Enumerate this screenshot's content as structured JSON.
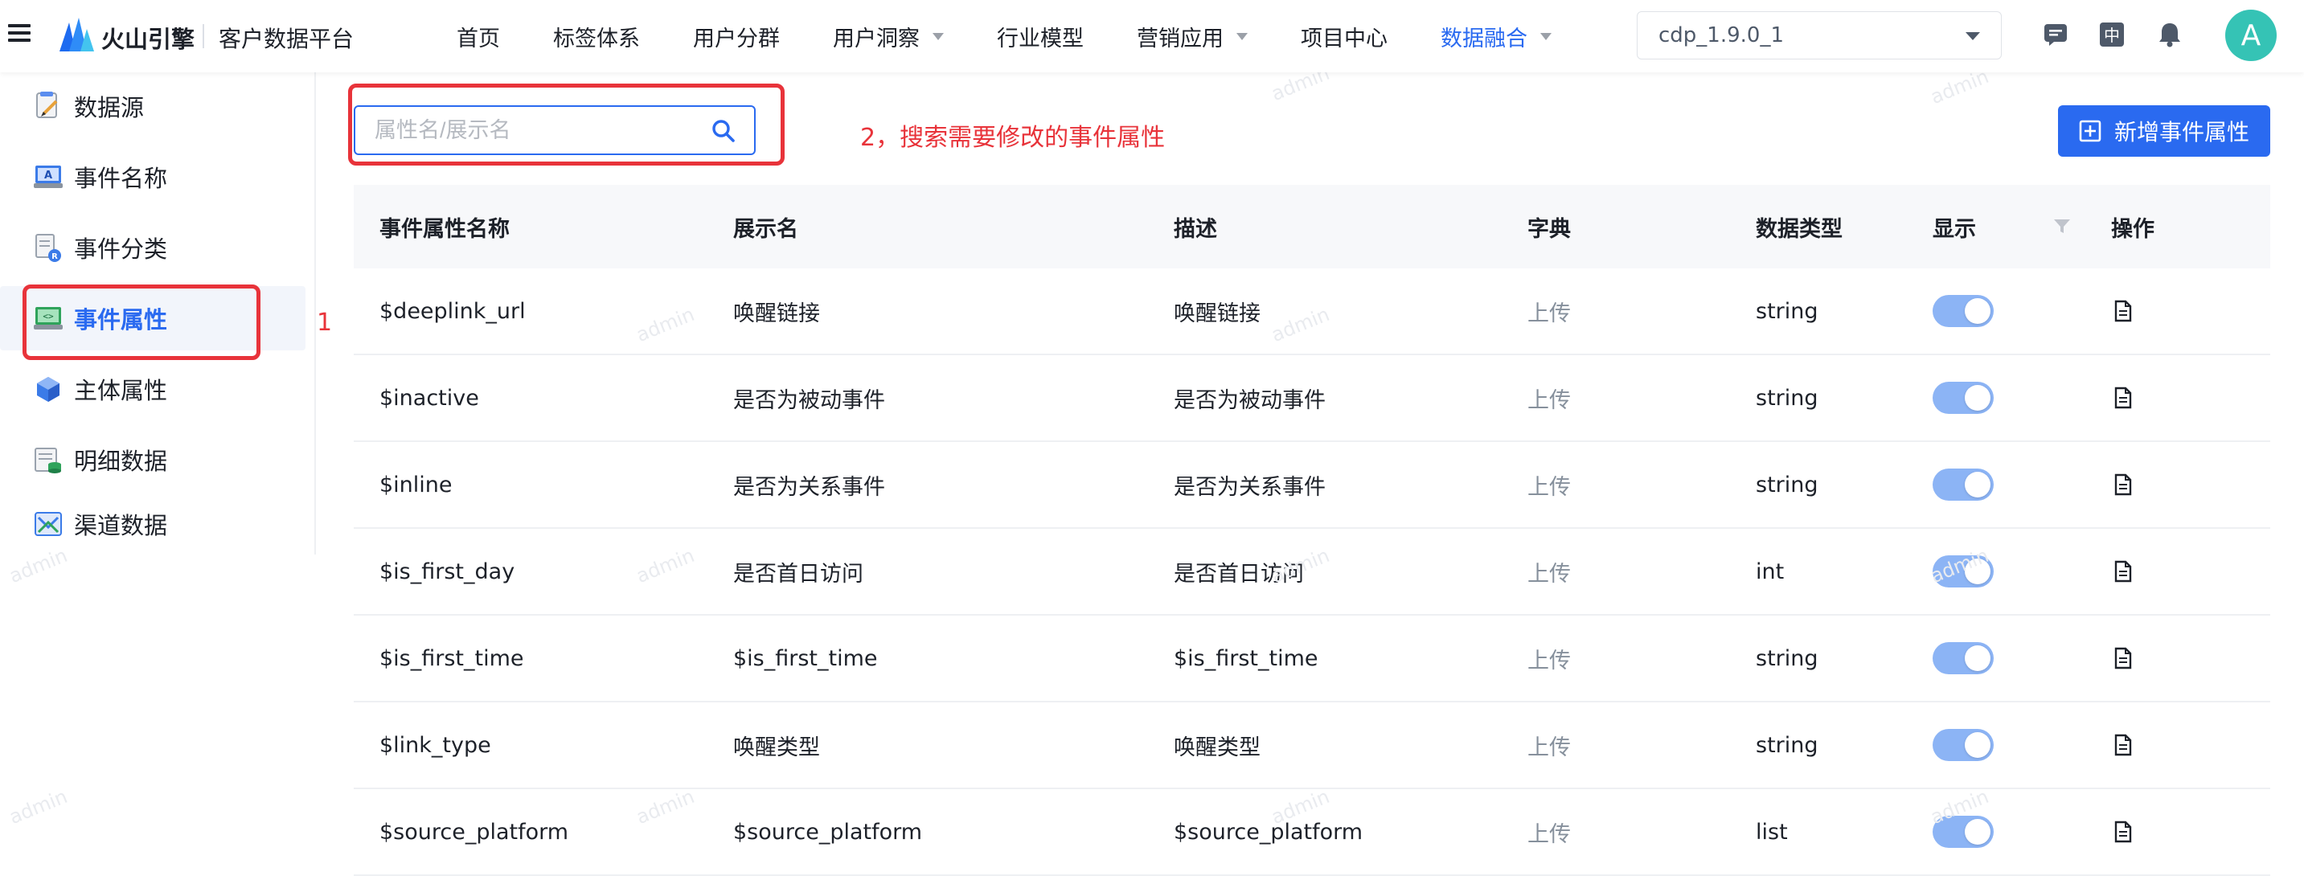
{
  "topbar": {
    "brand": "火山引擎",
    "platform": "客户数据平台",
    "nav": [
      {
        "label": "首页",
        "dropdown": false,
        "active": false
      },
      {
        "label": "标签体系",
        "dropdown": false,
        "active": false
      },
      {
        "label": "用户分群",
        "dropdown": false,
        "active": false
      },
      {
        "label": "用户洞察",
        "dropdown": true,
        "active": false
      },
      {
        "label": "行业模型",
        "dropdown": false,
        "active": false
      },
      {
        "label": "营销应用",
        "dropdown": true,
        "active": false
      },
      {
        "label": "项目中心",
        "dropdown": false,
        "active": false
      },
      {
        "label": "数据融合",
        "dropdown": true,
        "active": true
      }
    ],
    "version": "cdp_1.9.0_1",
    "lang_label": "中",
    "avatar_letter": "A",
    "icons": [
      "message-icon",
      "language-icon",
      "bell-icon"
    ]
  },
  "sidebar": {
    "items": [
      {
        "label": "数据源",
        "icon": "data-source-icon",
        "active": false
      },
      {
        "label": "事件名称",
        "icon": "event-name-icon",
        "active": false
      },
      {
        "label": "事件分类",
        "icon": "event-category-icon",
        "active": false
      },
      {
        "label": "事件属性",
        "icon": "event-property-icon",
        "active": true
      },
      {
        "label": "主体属性",
        "icon": "subject-property-icon",
        "active": false
      },
      {
        "label": "明细数据",
        "icon": "detail-data-icon",
        "active": false
      },
      {
        "label": "渠道数据",
        "icon": "channel-data-icon",
        "active": false
      }
    ]
  },
  "annotations": {
    "step1": "1",
    "step2": "2，搜索需要修改的事件属性"
  },
  "search": {
    "placeholder": "属性名/展示名",
    "value": ""
  },
  "add_button": {
    "label": "新增事件属性"
  },
  "table": {
    "columns": [
      "事件属性名称",
      "展示名",
      "描述",
      "字典",
      "数据类型",
      "显示",
      "操作"
    ],
    "rows": [
      {
        "name": "$deeplink_url",
        "display": "唤醒链接",
        "desc": "唤醒链接",
        "dict": "上传",
        "type": "string",
        "shown": true
      },
      {
        "name": "$inactive",
        "display": "是否为被动事件",
        "desc": "是否为被动事件",
        "dict": "上传",
        "type": "string",
        "shown": true
      },
      {
        "name": "$inline",
        "display": "是否为关系事件",
        "desc": "是否为关系事件",
        "dict": "上传",
        "type": "string",
        "shown": true
      },
      {
        "name": "$is_first_day",
        "display": "是否首日访问",
        "desc": "是否首日访问",
        "dict": "上传",
        "type": "int",
        "shown": true
      },
      {
        "name": "$is_first_time",
        "display": "$is_first_time",
        "desc": "$is_first_time",
        "dict": "上传",
        "type": "string",
        "shown": true
      },
      {
        "name": "$link_type",
        "display": "唤醒类型",
        "desc": "唤醒类型",
        "dict": "上传",
        "type": "string",
        "shown": true
      },
      {
        "name": "$source_platform",
        "display": "$source_platform",
        "desc": "$source_platform",
        "dict": "上传",
        "type": "list",
        "shown": true
      }
    ]
  },
  "colors": {
    "accent": "#2a6af0",
    "annotation": "#e8333a",
    "toggle_on": "#8cb4f5",
    "avatar": "#35c3b5"
  }
}
